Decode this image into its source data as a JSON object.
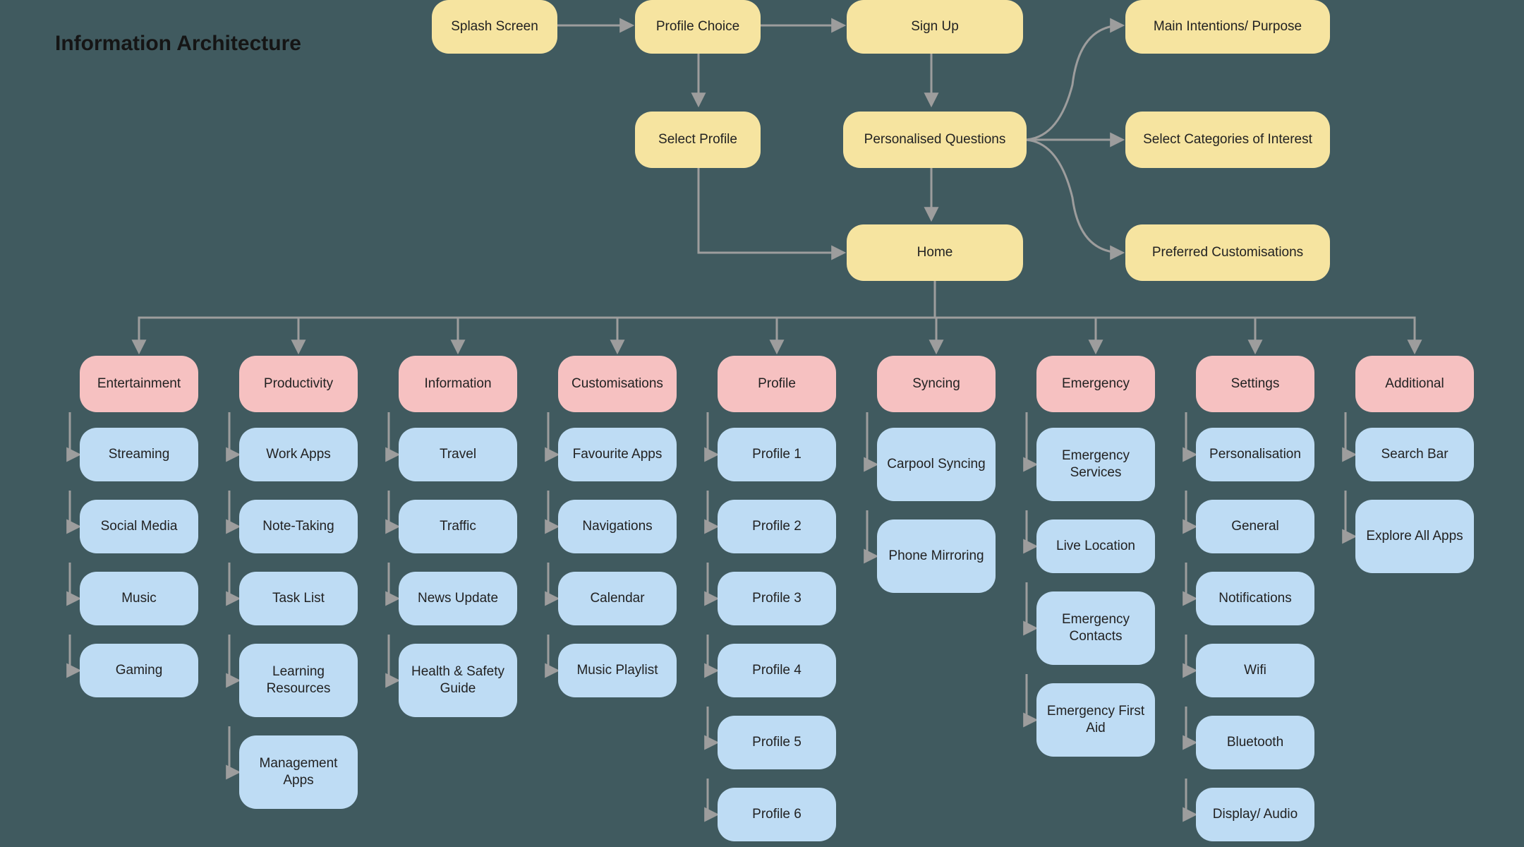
{
  "title": "Information Architecture",
  "top": {
    "splash": "Splash Screen",
    "profileChoice": "Profile Choice",
    "signUp": "Sign Up",
    "selectProfile": "Select Profile",
    "personalisedQ": "Personalised Questions",
    "mainIntentions": "Main Intentions/ Purpose",
    "selectCategories": "Select Categories of Interest",
    "preferredCustom": "Preferred Customisations",
    "home": "Home"
  },
  "cats": [
    {
      "label": "Entertainment",
      "items": [
        "Streaming",
        "Social Media",
        "Music",
        "Gaming"
      ]
    },
    {
      "label": "Productivity",
      "items": [
        "Work Apps",
        "Note-Taking",
        "Task List",
        "Learning Resources",
        "Management Apps"
      ]
    },
    {
      "label": "Information",
      "items": [
        "Travel",
        "Traffic",
        "News Update",
        "Health & Safety Guide"
      ]
    },
    {
      "label": "Customisations",
      "items": [
        "Favourite Apps",
        "Navigations",
        "Calendar",
        "Music Playlist"
      ]
    },
    {
      "label": "Profile",
      "items": [
        "Profile 1",
        "Profile 2",
        "Profile 3",
        "Profile 4",
        "Profile 5",
        "Profile 6"
      ]
    },
    {
      "label": "Syncing",
      "items": [
        "Carpool Syncing",
        "Phone Mirroring"
      ]
    },
    {
      "label": "Emergency",
      "items": [
        "Emergency Services",
        "Live Location",
        "Emergency Contacts",
        "Emergency First Aid"
      ]
    },
    {
      "label": "Settings",
      "items": [
        "Personalisation",
        "General",
        "Notifications",
        "Wifi",
        "Bluetooth",
        "Display/ Audio"
      ]
    },
    {
      "label": "Additional",
      "items": [
        "Search Bar",
        "Explore All Apps"
      ]
    }
  ],
  "chart_data": {
    "type": "table",
    "title": "Information Architecture",
    "hierarchy": {
      "Splash Screen": {
        "Profile Choice": {
          "Select Profile": {
            "Home": {}
          },
          "Sign Up": {
            "Personalised Questions": {
              "Home": {},
              "Main Intentions/ Purpose": {},
              "Select Categories of Interest": {},
              "Preferred Customisations": {}
            }
          }
        }
      },
      "Home_children": {
        "Entertainment": [
          "Streaming",
          "Social Media",
          "Music",
          "Gaming"
        ],
        "Productivity": [
          "Work Apps",
          "Note-Taking",
          "Task List",
          "Learning Resources",
          "Management Apps"
        ],
        "Information": [
          "Travel",
          "Traffic",
          "News Update",
          "Health & Safety Guide"
        ],
        "Customisations": [
          "Favourite Apps",
          "Navigations",
          "Calendar",
          "Music Playlist"
        ],
        "Profile": [
          "Profile 1",
          "Profile 2",
          "Profile 3",
          "Profile 4",
          "Profile 5",
          "Profile 6"
        ],
        "Syncing": [
          "Carpool Syncing",
          "Phone Mirroring"
        ],
        "Emergency": [
          "Emergency Services",
          "Live Location",
          "Emergency Contacts",
          "Emergency First Aid"
        ],
        "Settings": [
          "Personalisation",
          "General",
          "Notifications",
          "Wifi",
          "Bluetooth",
          "Display/ Audio"
        ],
        "Additional": [
          "Search Bar",
          "Explore All Apps"
        ]
      }
    }
  }
}
